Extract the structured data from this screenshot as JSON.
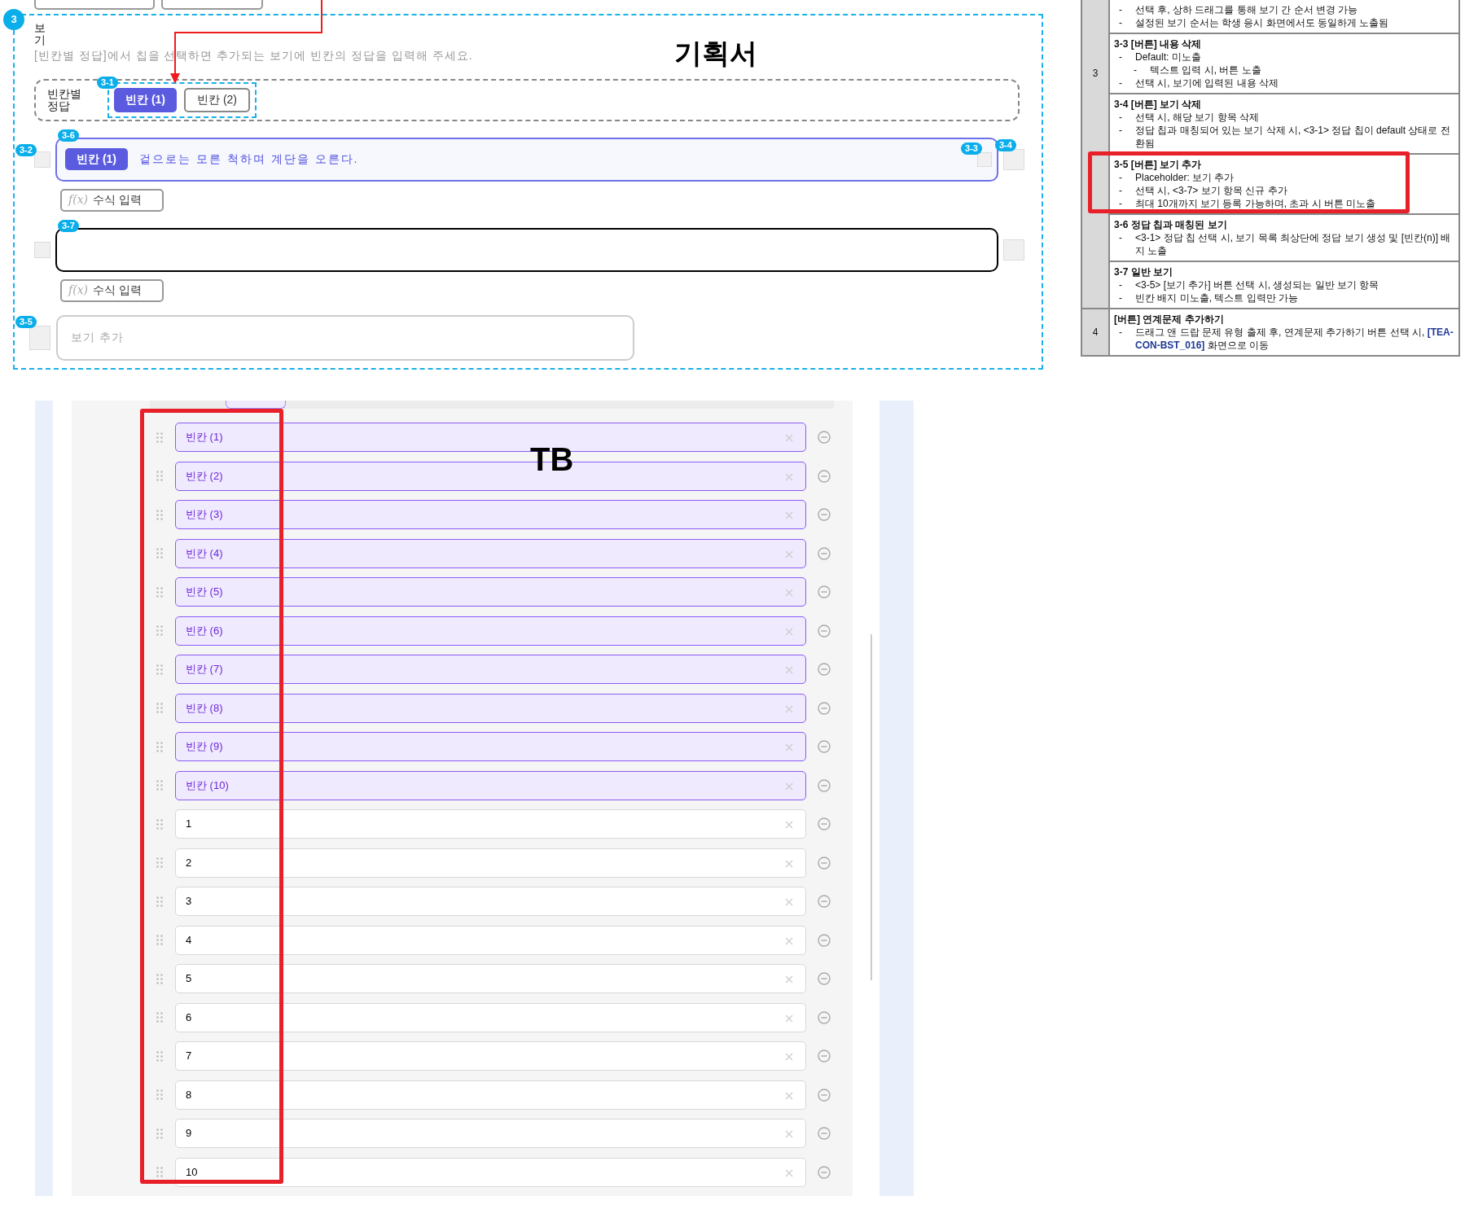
{
  "plan_label": "기획서",
  "section": {
    "number": "3",
    "title": "보기",
    "instruction": "[빈칸별 정답]에서 칩을 선택하면 추가되는 보기에 빈칸의 정답을 입력해 주세요.",
    "answer_chips": {
      "label": "빈칸별 정답",
      "tag": "3-1",
      "chips": [
        {
          "label": "빈칸 (1)",
          "selected": true
        },
        {
          "label": "빈칸 (2)",
          "selected": false
        }
      ]
    },
    "options": [
      {
        "kind": "answer",
        "tag": "3-6",
        "badge": "빈칸 (1)",
        "text": "겉으로는 모른 척하며 계단을 오른다.",
        "checkbox_tag": "3-2",
        "clear_tag": "3-3",
        "delete_tag": "3-4",
        "formula_glyph": "f(x)",
        "formula_label": "수식 입력"
      },
      {
        "kind": "plain",
        "tag": "3-7",
        "formula_glyph": "f(x)",
        "formula_label": "수식 입력"
      }
    ],
    "add_field": {
      "tag": "3-5",
      "placeholder": "보기 추가"
    }
  },
  "spec_table": {
    "bullet": "-",
    "groups": [
      {
        "number": "3",
        "items": [
          {
            "lines": [
              {
                "text": "선택 후, 상하 드래그를 통해 보기 간 순서 변경 가능"
              },
              {
                "text": "설정된 보기 순서는 학생 응시 화면에서도 동일하게 노출됨"
              }
            ]
          },
          {
            "heading": "3-3 [버튼] 내용 삭제",
            "lines": [
              {
                "text": "Default: 미노출",
                "children": [
                  {
                    "text": "텍스트 입력 시, 버튼 노출"
                  }
                ]
              },
              {
                "text": "선택 시, 보기에 입력된 내용 삭제"
              }
            ]
          },
          {
            "heading": "3-4 [버튼] 보기 삭제",
            "lines": [
              {
                "text": "선택 시, 해당 보기 항목 삭제"
              },
              {
                "text": "정답 칩과 매칭되어 있는 보기 삭제 시, <3-1> 정답 칩이 default 상태로 전환됨"
              }
            ]
          },
          {
            "heading": "3-5 [버튼] 보기 추가",
            "highlighted": true,
            "lines": [
              {
                "text": "Placeholder: 보기 추가"
              },
              {
                "text": "선택 시, <3-7> 보기 항목 신규 추가"
              },
              {
                "text": "최대 10개까지 보기 등록 가능하며, 초과 시 버튼 미노출"
              }
            ]
          },
          {
            "heading": "3-6 정답 칩과 매칭된 보기",
            "lines": [
              {
                "text": "<3-1> 정답 칩 선택 시, 보기 목록 최상단에 정답 보기 생성 및 [빈칸(n)] 배지 노출"
              }
            ]
          },
          {
            "heading": "3-7 일반 보기",
            "lines": [
              {
                "text": "<3-5> [보기 추가] 버튼 선택 시, 생성되는 일반 보기 항목"
              },
              {
                "text": "빈칸 배지 미노출, 텍스트 입력만 가능"
              }
            ]
          }
        ]
      },
      {
        "number": "4",
        "items": [
          {
            "heading": "[버튼] 연계문제 추가하기",
            "lines": [
              {
                "text": "드래그 앤 드랍 문제 유형 출제 후, 연계문제 추가하기 버튼 선택 시, **[TEA-CON-BST_016]** 화면으로 이동"
              }
            ]
          }
        ]
      }
    ]
  },
  "tb_label": "TB",
  "option_list": [
    {
      "kind": "blank",
      "text": "빈칸 (1)"
    },
    {
      "kind": "blank",
      "text": "빈칸 (2)"
    },
    {
      "kind": "blank",
      "text": "빈칸 (3)"
    },
    {
      "kind": "blank",
      "text": "빈칸 (4)"
    },
    {
      "kind": "blank",
      "text": "빈칸 (5)"
    },
    {
      "kind": "blank",
      "text": "빈칸 (6)"
    },
    {
      "kind": "blank",
      "text": "빈칸 (7)"
    },
    {
      "kind": "blank",
      "text": "빈칸 (8)"
    },
    {
      "kind": "blank",
      "text": "빈칸 (9)"
    },
    {
      "kind": "blank",
      "text": "빈칸 (10)"
    },
    {
      "kind": "plain",
      "text": "1"
    },
    {
      "kind": "plain",
      "text": "2"
    },
    {
      "kind": "plain",
      "text": "3"
    },
    {
      "kind": "plain",
      "text": "4"
    },
    {
      "kind": "plain",
      "text": "5"
    },
    {
      "kind": "plain",
      "text": "6"
    },
    {
      "kind": "plain",
      "text": "7"
    },
    {
      "kind": "plain",
      "text": "8"
    },
    {
      "kind": "plain",
      "text": "9"
    },
    {
      "kind": "plain",
      "text": "10"
    }
  ]
}
